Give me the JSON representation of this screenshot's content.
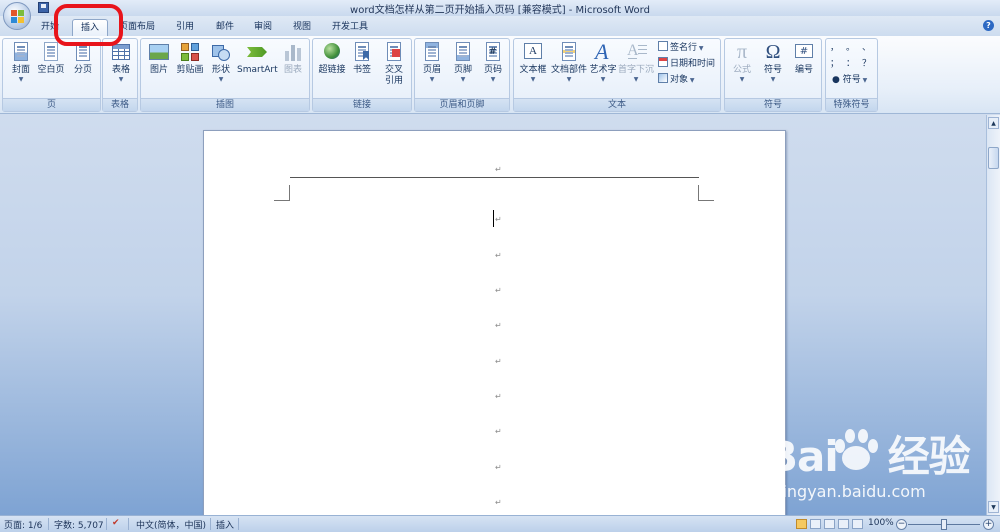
{
  "window": {
    "title": "word文档怎样从第二页开始插入页码 [兼容模式] - Microsoft Word"
  },
  "tabs": [
    {
      "label": "开始"
    },
    {
      "label": "插入"
    },
    {
      "label": "页面布局"
    },
    {
      "label": "引用"
    },
    {
      "label": "邮件"
    },
    {
      "label": "审阅"
    },
    {
      "label": "视图"
    },
    {
      "label": "开发工具"
    }
  ],
  "active_tab": "插入",
  "ribbon": {
    "groups": {
      "pages": {
        "label": "页",
        "buttons": {
          "cover": "封面",
          "blank": "空白页",
          "break": "分页"
        }
      },
      "tables": {
        "label": "表格",
        "buttons": {
          "table": "表格"
        }
      },
      "illustrations": {
        "label": "插图",
        "buttons": {
          "picture": "图片",
          "clipart": "剪贴画",
          "shapes": "形状",
          "smartart": "SmartArt",
          "chart": "图表"
        }
      },
      "links": {
        "label": "链接",
        "buttons": {
          "hyperlink": "超链接",
          "bookmark": "书签",
          "crossref_1": "交叉",
          "crossref_2": "引用"
        }
      },
      "header_footer": {
        "label": "页眉和页脚",
        "buttons": {
          "header": "页眉",
          "footer": "页脚",
          "page_number": "页码"
        }
      },
      "text": {
        "label": "文本",
        "buttons": {
          "textbox": "文本框",
          "quickparts": "文档部件",
          "wordart": "艺术字",
          "dropcap": "首字下沉"
        },
        "small": {
          "signature": "签名行",
          "datetime": "日期和时间",
          "object": "对象"
        }
      },
      "symbols": {
        "label": "符号",
        "buttons": {
          "equation": "公式",
          "symbol": "符号",
          "numbering": "编号"
        },
        "glyphs": {
          "equation": "π",
          "symbol": "Ω",
          "numbering": "#"
        }
      },
      "special": {
        "label": "特殊符号",
        "glyphs": [
          "，",
          "。",
          "、",
          "；",
          "：",
          "？"
        ],
        "symbol_btn": "符号"
      }
    }
  },
  "document": {
    "para_mark": "↵"
  },
  "statusbar": {
    "page": "页面: 1/6",
    "words": "字数: 5,707",
    "language": "中文(简体，中国)",
    "mode": "插入",
    "zoom": "100%",
    "zoom_minus": "−",
    "zoom_plus": "+"
  },
  "watermark": {
    "brand_left": "Bai",
    "brand_right": "经验",
    "site": "jingyan.baidu.com"
  },
  "colors": {
    "highlight": "#e8141b",
    "accent": "#2d69c3"
  }
}
